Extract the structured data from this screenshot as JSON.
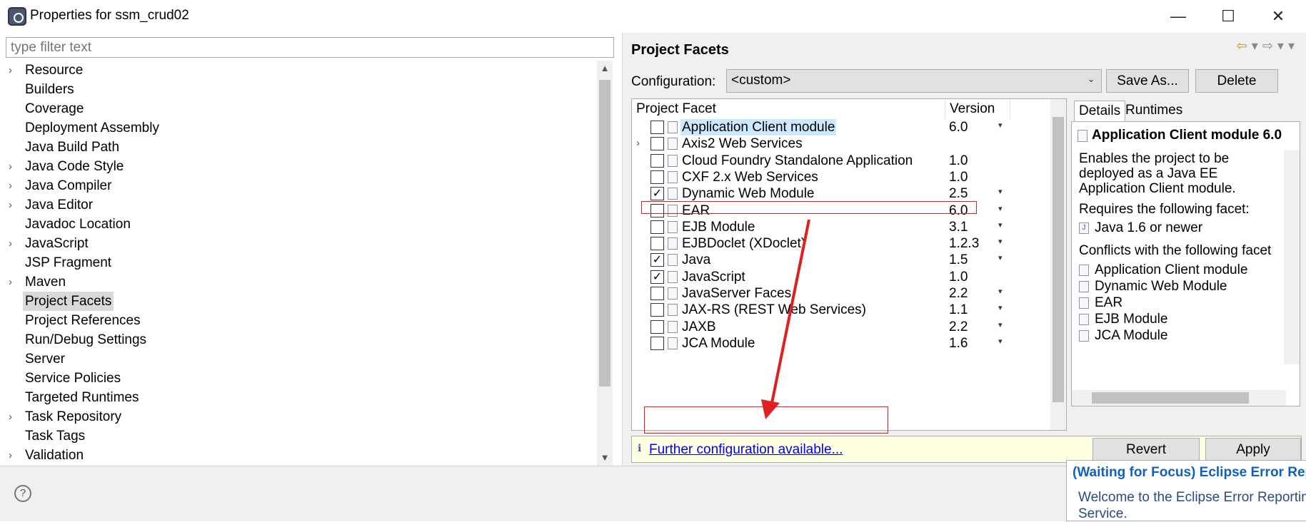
{
  "window": {
    "title": "Properties for ssm_crud02",
    "minimize": "—",
    "maximize": "☐",
    "close": "✕"
  },
  "left": {
    "filter_placeholder": "type filter text",
    "tree": [
      {
        "label": "Resource",
        "expandable": true
      },
      {
        "label": "Builders",
        "expandable": false
      },
      {
        "label": "Coverage",
        "expandable": false
      },
      {
        "label": "Deployment Assembly",
        "expandable": false
      },
      {
        "label": "Java Build Path",
        "expandable": false
      },
      {
        "label": "Java Code Style",
        "expandable": true
      },
      {
        "label": "Java Compiler",
        "expandable": true
      },
      {
        "label": "Java Editor",
        "expandable": true
      },
      {
        "label": "Javadoc Location",
        "expandable": false
      },
      {
        "label": "JavaScript",
        "expandable": true
      },
      {
        "label": "JSP Fragment",
        "expandable": false
      },
      {
        "label": "Maven",
        "expandable": true
      },
      {
        "label": "Project Facets",
        "expandable": false,
        "selected": true
      },
      {
        "label": "Project References",
        "expandable": false
      },
      {
        "label": "Run/Debug Settings",
        "expandable": false
      },
      {
        "label": "Server",
        "expandable": false
      },
      {
        "label": "Service Policies",
        "expandable": false
      },
      {
        "label": "Targeted Runtimes",
        "expandable": false
      },
      {
        "label": "Task Repository",
        "expandable": true
      },
      {
        "label": "Task Tags",
        "expandable": false
      },
      {
        "label": "Validation",
        "expandable": true
      }
    ]
  },
  "right": {
    "page_title": "Project Facets",
    "config_label": "Configuration:",
    "config_value": "<custom>",
    "save_as": "Save As...",
    "delete": "Delete",
    "col_facet": "Project Facet",
    "col_version": "Version",
    "facets": [
      {
        "name": "Application Client module",
        "version": "6.0",
        "checked": false,
        "dropdown": true,
        "selected": true,
        "expand": false
      },
      {
        "name": "Axis2 Web Services",
        "version": "",
        "checked": false,
        "dropdown": false,
        "expand": true
      },
      {
        "name": "Cloud Foundry Standalone Application",
        "version": "1.0",
        "checked": false,
        "dropdown": false,
        "expand": false
      },
      {
        "name": "CXF 2.x Web Services",
        "version": "1.0",
        "checked": false,
        "dropdown": false,
        "expand": false
      },
      {
        "name": "Dynamic Web Module",
        "version": "2.5",
        "checked": true,
        "dropdown": true,
        "expand": false
      },
      {
        "name": "EAR",
        "version": "6.0",
        "checked": false,
        "dropdown": true,
        "expand": false
      },
      {
        "name": "EJB Module",
        "version": "3.1",
        "checked": false,
        "dropdown": true,
        "expand": false
      },
      {
        "name": "EJBDoclet (XDoclet)",
        "version": "1.2.3",
        "checked": false,
        "dropdown": true,
        "expand": false
      },
      {
        "name": "Java",
        "version": "1.5",
        "checked": true,
        "dropdown": true,
        "expand": false
      },
      {
        "name": "JavaScript",
        "version": "1.0",
        "checked": true,
        "dropdown": false,
        "expand": false
      },
      {
        "name": "JavaServer Faces",
        "version": "2.2",
        "checked": false,
        "dropdown": true,
        "expand": false
      },
      {
        "name": "JAX-RS (REST Web Services)",
        "version": "1.1",
        "checked": false,
        "dropdown": true,
        "expand": false
      },
      {
        "name": "JAXB",
        "version": "2.2",
        "checked": false,
        "dropdown": true,
        "expand": false
      },
      {
        "name": "JCA Module",
        "version": "1.6",
        "checked": false,
        "dropdown": true,
        "expand": false
      }
    ],
    "tabs": [
      "Details",
      "Runtimes"
    ],
    "details": {
      "title": "Application Client module 6.0",
      "description": [
        "Enables the project to be",
        "deployed as a Java EE",
        "Application Client module."
      ],
      "requires_label": "Requires the following facet:",
      "requires": [
        "Java 1.6 or newer"
      ],
      "conflicts_label": "Conflicts with the following facet",
      "conflicts": [
        "Application Client module",
        "Dynamic Web Module",
        "EAR",
        "EJB Module",
        "JCA Module"
      ]
    },
    "info_link": "Further configuration available...",
    "revert": "Revert",
    "apply": "Apply"
  },
  "notification": {
    "title": "(Waiting for Focus) Eclipse Error Rep",
    "body_line1": "Welcome to the Eclipse Error Reportin",
    "body_line2": "Service."
  },
  "colors": {
    "highlight_box": "#e02020",
    "link": "#0000ee"
  }
}
